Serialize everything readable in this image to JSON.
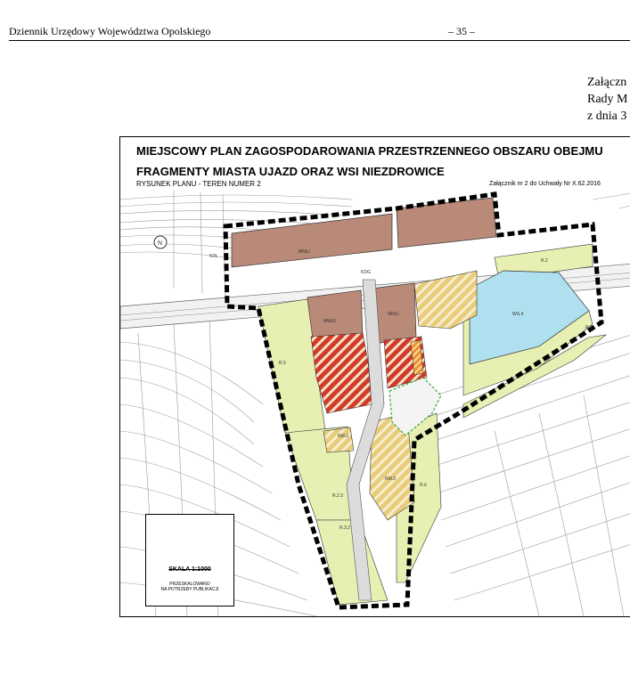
{
  "header": {
    "journal": "Dziennik Urzędowy Województwa Opolskiego",
    "page": "– 35 –"
  },
  "attachment": {
    "line1": "Załączn",
    "line2": "Rady M",
    "line3": "z dnia 3"
  },
  "map": {
    "title_line1": "MIEJSCOWY PLAN ZAGOSPODAROWANIA PRZESTRZENNEGO OBSZARU OBEJMU",
    "title_line2": "FRAGMENTY MIASTA UJAZD ORAZ WSI NIEZDROWICE",
    "drawing_label": "RYSUNEK PLANU - TEREN NUMER 2",
    "resolution_note": "Załącznik nr 2 do Uchwały Nr X.62.2016",
    "scale": "SKALA 1:1000",
    "publication_note_line1": "PRZESKALOWANO",
    "publication_note_line2": "NA POTRZEBY PUBLIKACJI",
    "zone_labels": [
      "MN/U",
      "KDG",
      "KDL",
      "MW/U",
      "MN/U",
      "WS.4",
      "R.2",
      "R.4",
      "R.5",
      "R.6",
      "RM.2",
      "RM.3",
      "R.2.3",
      "R.3.2"
    ]
  }
}
